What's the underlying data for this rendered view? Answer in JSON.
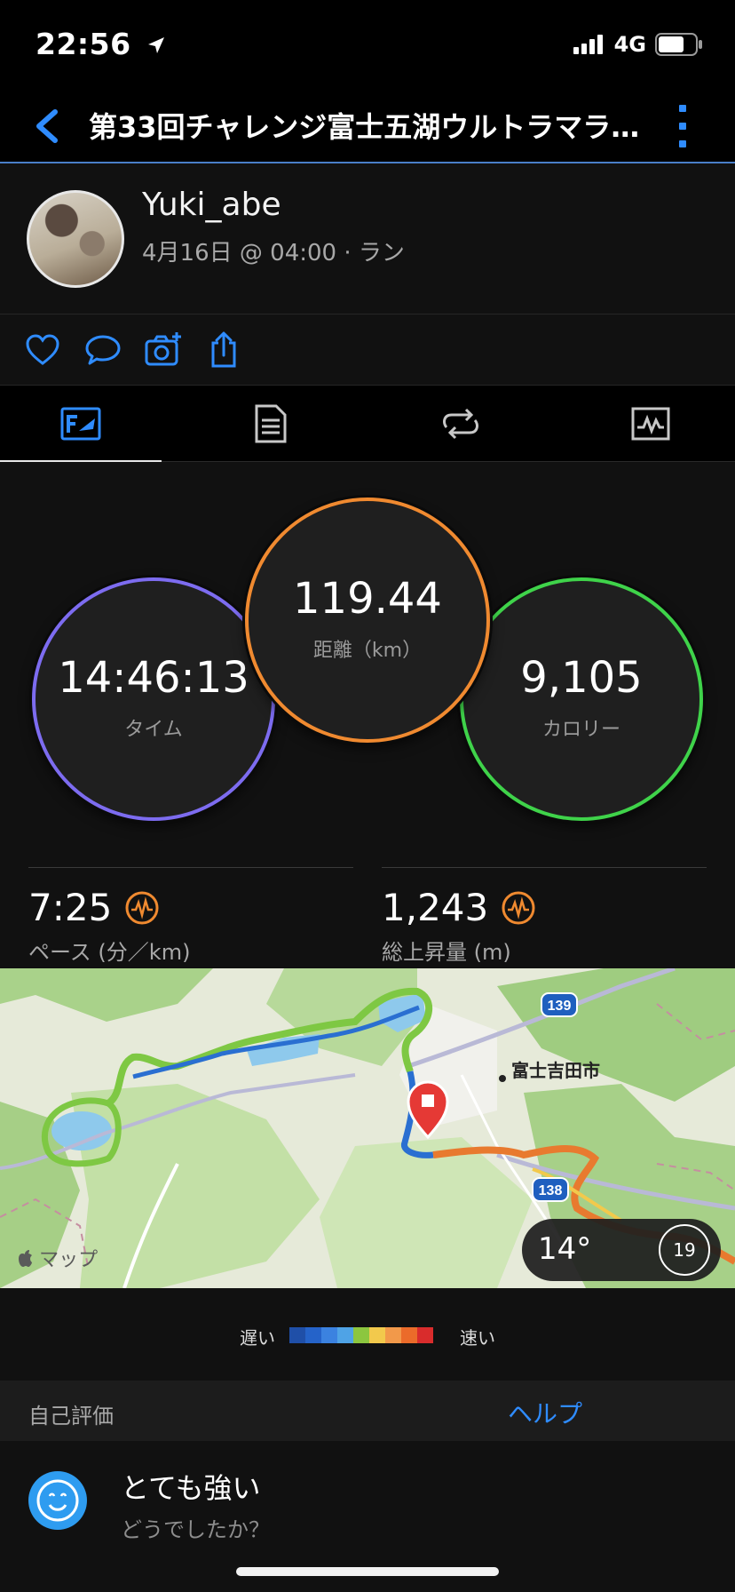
{
  "status": {
    "time": "22:56",
    "network": "4G"
  },
  "header": {
    "title": "第33回チャレンジ富士五湖ウルトラマラ…"
  },
  "profile": {
    "name": "Yuki_abe",
    "meta": "4月16日 @ 04:00 · ラン"
  },
  "actions": [
    {
      "icon": "heart-icon"
    },
    {
      "icon": "comment-icon"
    },
    {
      "icon": "add-photo-icon"
    },
    {
      "icon": "share-icon"
    }
  ],
  "tabs": [
    {
      "icon": "overview-icon",
      "active": true
    },
    {
      "icon": "details-icon",
      "active": false
    },
    {
      "icon": "laps-icon",
      "active": false
    },
    {
      "icon": "charts-icon",
      "active": false
    }
  ],
  "stats": {
    "time": {
      "value": "14:46:13",
      "label": "タイム",
      "color": "#7d6cf0"
    },
    "distance": {
      "value": "119.44",
      "label": "距離（km）",
      "color": "#f08a30"
    },
    "calories": {
      "value": "9,105",
      "label": "カロリー",
      "color": "#3fd34a"
    }
  },
  "metrics": {
    "pace": {
      "value": "7:25",
      "label": "ペース (分／km)"
    },
    "ascent": {
      "value": "1,243",
      "label": "総上昇量 (m)"
    }
  },
  "map": {
    "attribution": "マップ",
    "city_label": "富士吉田市",
    "route_shields": [
      "139",
      "138"
    ],
    "weather": {
      "temp": "14°",
      "dial": "19"
    }
  },
  "legend": {
    "slow": "遅い",
    "fast": "速い",
    "colors": [
      "#1f4fa8",
      "#2563c9",
      "#3b82e0",
      "#4fa3e6",
      "#8cc63f",
      "#f2c94c",
      "#f2994a",
      "#eb6b2a",
      "#d92c2c"
    ]
  },
  "evaluation": {
    "title": "自己評価",
    "help": "ヘルプ",
    "value": "とても強い",
    "question": "どうでしたか？"
  }
}
